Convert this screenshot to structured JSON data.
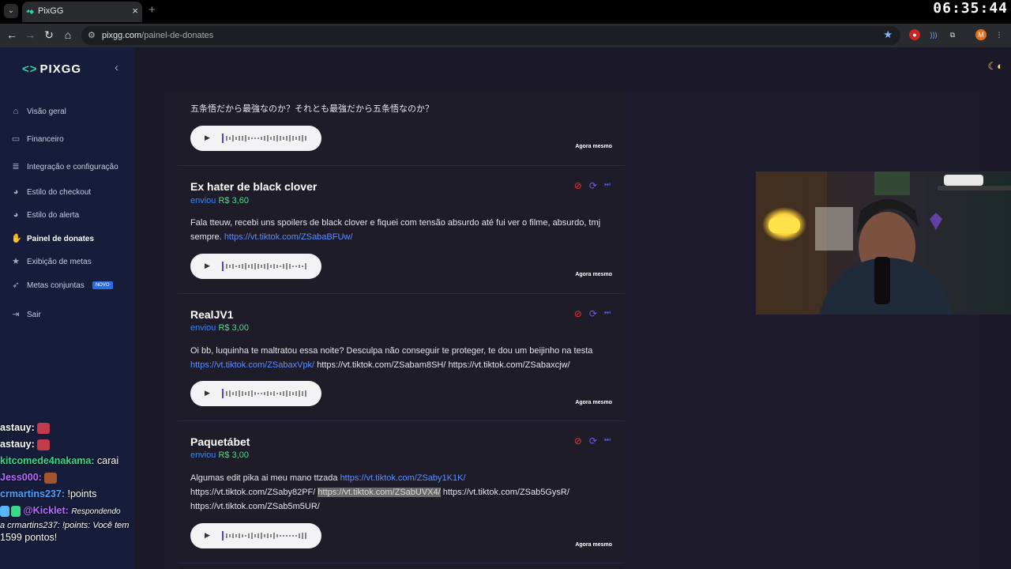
{
  "browser": {
    "tab_title": "PixGG",
    "tab_close": "×",
    "new_tab": "+",
    "url_host": "pixgg.com",
    "url_path": "/painel-de-donates",
    "clock": "06:35:44",
    "profile_initial": "M"
  },
  "sidebar": {
    "logo": "PIXGG",
    "collapse": "‹",
    "items": [
      {
        "label": "Visão geral",
        "icon": "home-icon"
      },
      {
        "label": "Financeiro",
        "icon": "wallet-icon"
      },
      {
        "label": "Integração e configuração",
        "icon": "list-icon"
      },
      {
        "label": "Estilo do checkout",
        "icon": "palette-icon"
      },
      {
        "label": "Estilo do alerta",
        "icon": "palette-icon"
      },
      {
        "label": "Painel de donates",
        "icon": "hand-coin-icon"
      },
      {
        "label": "Exibição de metas",
        "icon": "star-icon"
      },
      {
        "label": "Metas conjuntas",
        "icon": "rocket-icon",
        "badge": "NOVO"
      },
      {
        "label": "Sair",
        "icon": "logout-icon"
      }
    ]
  },
  "donations": [
    {
      "name": "",
      "prefix": "",
      "amount": "",
      "message": "五条悟だから最強なのか？それとも最強だから五条悟なのか？",
      "links": [],
      "time": "Agora mesmo"
    },
    {
      "name": "Ex hater de black clover",
      "prefix": "enviou",
      "amount": "R$ 3,60",
      "message": "Fala tteuw, recebi uns spoilers de black clover e fiquei com tensão absurdo até fui ver o filme, absurdo, tmj sempre.",
      "link1": "https://vt.tiktok.com/ZSabaBFUw/",
      "time": "Agora mesmo"
    },
    {
      "name": "RealJV1",
      "prefix": "enviou",
      "amount": "R$ 3,00",
      "message": "Oi bb, luquinha te maltratou essa noite? Desculpa não conseguir te proteger, te dou um beijinho na testa",
      "link1": "https://vt.tiktok.com/ZSabaxVpk/",
      "link_rest": "https://vt.tiktok.com/ZSabam8SH/ https://vt.tiktok.com/ZSabaxcjw/",
      "time": "Agora mesmo"
    },
    {
      "name": "Paquetábet",
      "prefix": "enviou",
      "amount": "R$ 3,00",
      "message": "Algumas edit pika ai meu mano ttzada",
      "link1": "https://vt.tiktok.com/ZSaby1K1K/",
      "link2": "https://vt.tiktok.com/ZSaby82PF/",
      "link_selected": "https://vt.tiktok.com/ZSabUVX4/",
      "link3": "https://vt.tiktok.com/ZSab5GysR/",
      "link4": "https://vt.tiktok.com/ZSab5m5UR/",
      "time": "Agora mesmo"
    }
  ],
  "chat": [
    {
      "user": "astauy:",
      "color": "#ffffff",
      "msg": ""
    },
    {
      "user": "astauy:",
      "color": "#ffffff",
      "msg": ""
    },
    {
      "user": "kitcomede4nakama:",
      "color": "#39d98a",
      "msg": "carai"
    },
    {
      "user": "Jess000:",
      "color": "#b46cff",
      "msg": ""
    },
    {
      "user": "crmartins237:",
      "color": "#4aa3ff",
      "msg": "!points"
    },
    {
      "user": "@Kicklet:",
      "color": "#b46cff",
      "msg": "Respondendo"
    },
    {
      "user": "",
      "color": "#ffffff",
      "msg": "a crmartins237: !points: Você tem"
    },
    {
      "user": "",
      "color": "#ffffff",
      "msg": "1599 pontos!"
    }
  ]
}
